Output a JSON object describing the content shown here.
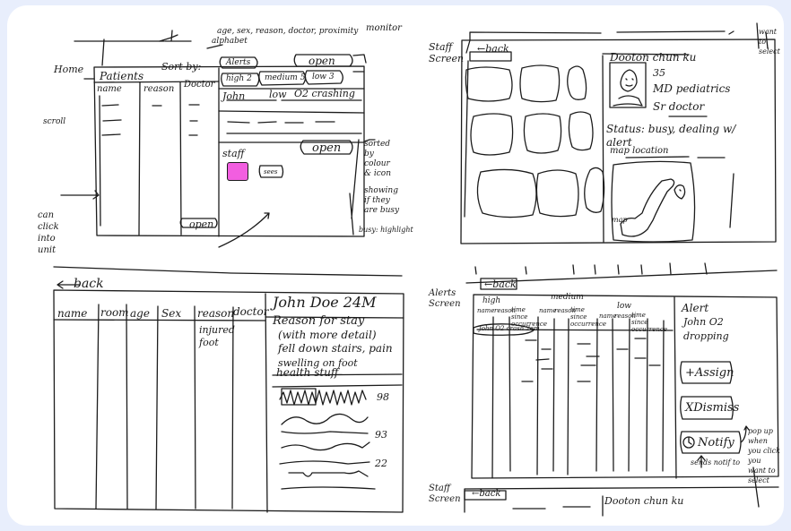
{
  "sketch1": {
    "home": "Home",
    "scroll": "scroll",
    "patients_title": "Patients",
    "sort_by": "Sort by:",
    "sort_options_note_1": "alphabet",
    "sort_options_note_2": "age, sex, reason, doctor, proximity",
    "monitor": "monitor",
    "alerts": "Alerts",
    "open_top": "open",
    "tabs": [
      "high 2",
      "medium 5",
      "low 3"
    ],
    "col_headers": [
      "name",
      "reason",
      "Doctor"
    ],
    "alert_row": "John",
    "alert_level": "low",
    "alert_reason": "O2 crashing",
    "staff": "staff",
    "open_staff": "open",
    "open_bottom": "open",
    "staff_box2": "sees",
    "note_sorted": "sorted by colour & icon",
    "note_busy_show": "showing if they are busy",
    "note_busy_highlight": "busy: highlight",
    "note_click": "can click into unit"
  },
  "sketch2": {
    "label": "Staff Screen",
    "back": "back",
    "name": "Dooton chun ku",
    "age": "35",
    "role1": "MD pediatrics",
    "role2": "Sr doctor",
    "status": "Status: busy, dealing w/ alert",
    "map_note": "map location",
    "map_label": "map",
    "side_note": "want to select"
  },
  "sketch3": {
    "back": "back",
    "cols": [
      "name",
      "room",
      "age",
      "Sex",
      "reason",
      "doctor"
    ],
    "cell_reason": "injured foot",
    "patient": "John Doe 24M",
    "reason_title": "Reason for stay",
    "reason_detail": "(with more detail)",
    "reason_text_1": "fell down stairs, pain",
    "reason_text_2": "swelling on foot",
    "health": "health stuff",
    "vital_values": [
      "98",
      "93",
      "22"
    ]
  },
  "sketch4": {
    "label": "Alerts Screen",
    "back": "back",
    "groups": [
      "high",
      "medium",
      "low"
    ],
    "subcols": [
      "name",
      "reason",
      "time since occurrence"
    ],
    "row": "John O2 crash 2am",
    "alert_title": "Alert",
    "alert_text_1": "John O2",
    "alert_text_2": "dropping",
    "assign": "+Assign",
    "dismiss": "XDismiss",
    "notify": "Notify",
    "sends_note": "sends notif to",
    "popup_note": "pop up when you click you want to select"
  },
  "sketch5": {
    "label": "Staff Screen",
    "back": "back",
    "name": "Dooton chun ku"
  },
  "colors": {
    "paper": "#ffffff",
    "frame": "#e8eefc",
    "ink": "#1c1c1c",
    "highlight": "#f25ee0"
  }
}
